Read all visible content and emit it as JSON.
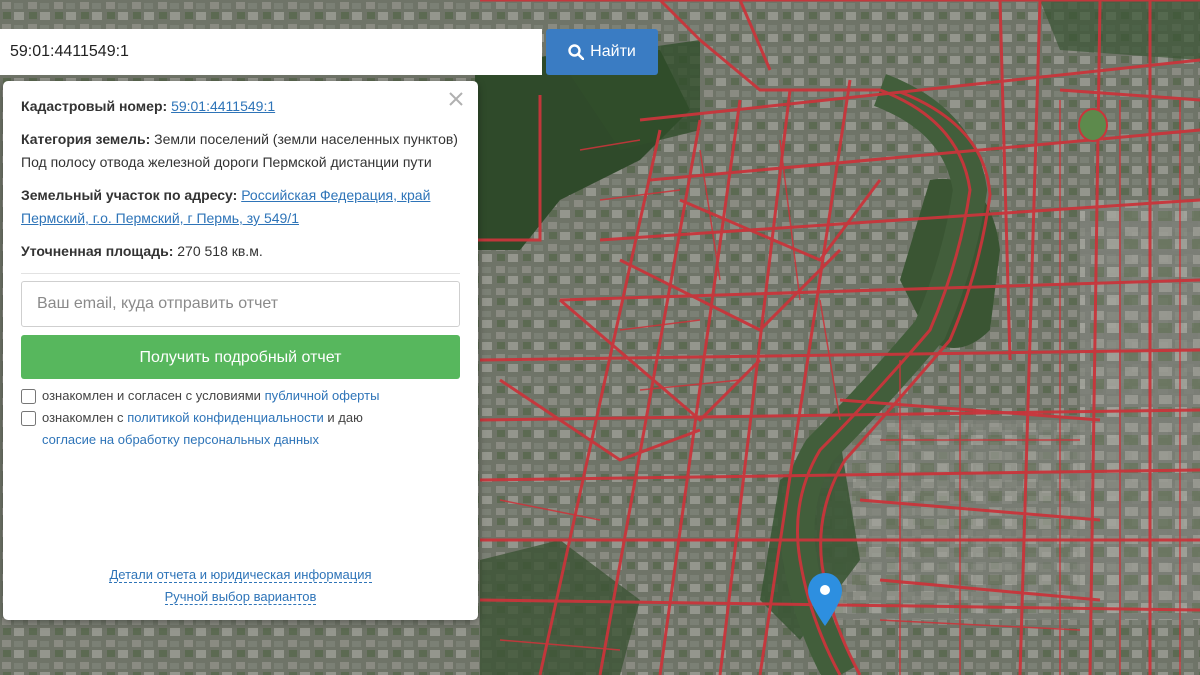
{
  "search": {
    "value": "59:01:4411549:1",
    "button_label": "Найти"
  },
  "popup": {
    "cadastral_label": "Кадастровый номер:",
    "cadastral_value": "59:01:4411549:1",
    "category_label": "Категория земель:",
    "category_value": "Земли поселений (земли населенных пунктов)",
    "category_note": "Под полосу отвода железной дороги Пермской дистанции пути",
    "address_label": "Земельный участок по адресу:",
    "address_value": "Российская Федерация, край Пермский, г.о. Пермский, г Пермь, зу 549/1",
    "area_label": "Уточненная площадь:",
    "area_value": "270 518 кв.м.",
    "email_placeholder": "Ваш email, куда отправить отчет",
    "report_button": "Получить подробный отчет",
    "agree1_text": "ознакомлен и согласен с условиями",
    "agree1_link": "публичной оферты",
    "agree2_text": "ознакомлен с",
    "agree2_link": "политикой конфиденциальности",
    "agree2_text2": "и даю",
    "agree2_link2": "согласие на обработку персональных данных",
    "details_link": "Детали отчета и юридическая информация",
    "manual_link": "Ручной выбор вариантов"
  },
  "colors": {
    "parcel_line": "#c9353b",
    "button_blue": "#3a7cc3",
    "button_green": "#57b75d",
    "link": "#2e74b8",
    "marker": "#2d8fe0"
  },
  "icons": [
    "search-icon",
    "close-icon",
    "map-marker-icon"
  ]
}
